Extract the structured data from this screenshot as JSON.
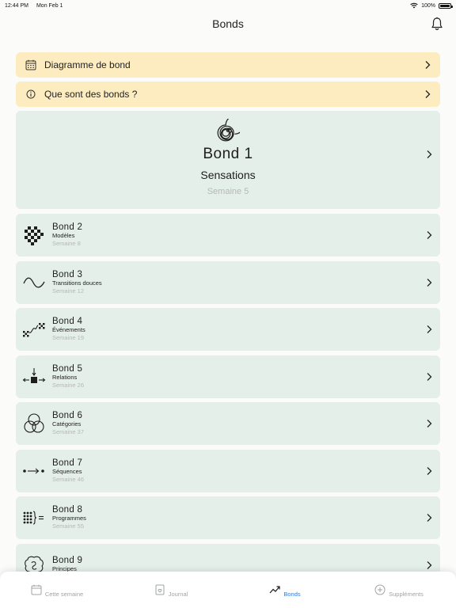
{
  "status": {
    "time": "12:44 PM",
    "date": "Mon Feb 1",
    "battery": "100%"
  },
  "header": {
    "title": "Bonds",
    "bell_icon": "bell-icon"
  },
  "info_rows": [
    {
      "label": "Diagramme de bond",
      "icon": "calendar-icon"
    },
    {
      "label": "Que sont des bonds ?",
      "icon": "info-icon"
    }
  ],
  "hero": {
    "title": "Bond  1",
    "name": "Sensations",
    "week": "Semaine 5",
    "icon": "spiral-icon"
  },
  "leaps": [
    {
      "title": "Bond  2",
      "name": "Modèles",
      "week": "Semaine 8",
      "icon": "checker-pattern-icon"
    },
    {
      "title": "Bond  3",
      "name": "Transitions douces",
      "week": "Semaine 12",
      "icon": "wave-icon"
    },
    {
      "title": "Bond  4",
      "name": "Événements",
      "week": "Semaine 19",
      "icon": "event-path-icon"
    },
    {
      "title": "Bond  5",
      "name": "Relations",
      "week": "Semaine 26",
      "icon": "relations-arrows-icon"
    },
    {
      "title": "Bond  6",
      "name": "Catégories",
      "week": "Semaine 37",
      "icon": "venn-circles-icon"
    },
    {
      "title": "Bond  7",
      "name": "Séquences",
      "week": "Semaine 46",
      "icon": "sequence-arrow-icon"
    },
    {
      "title": "Bond  8",
      "name": "Programmes",
      "week": "Semaine 55",
      "icon": "dot-grid-bracket-icon"
    },
    {
      "title": "Bond  9",
      "name": "Principes",
      "week": "",
      "icon": "brain-icon"
    }
  ],
  "tabs": [
    {
      "label": "Cette semaine",
      "icon": "calendar-icon",
      "active": false
    },
    {
      "label": "Journal",
      "icon": "journal-icon",
      "active": false
    },
    {
      "label": "Bonds",
      "icon": "trend-up-icon",
      "active": true
    },
    {
      "label": "Suppléments",
      "icon": "plus-circle-icon",
      "active": false
    }
  ],
  "colors": {
    "info_bg": "#fcecc0",
    "card_bg": "#e5efea",
    "active_tab": "#2f7be0",
    "muted": "#b5b9b6"
  }
}
